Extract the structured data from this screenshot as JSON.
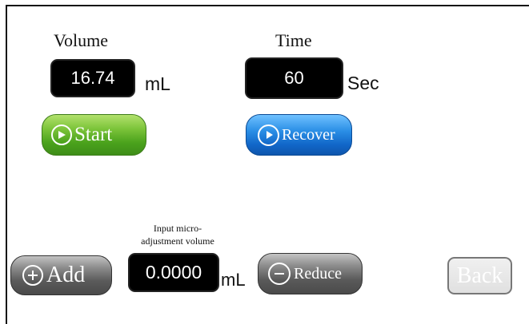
{
  "volume": {
    "label": "Volume",
    "value": "16.74",
    "unit": "mL"
  },
  "time": {
    "label": "Time",
    "value": "60",
    "unit": "Sec"
  },
  "buttons": {
    "start": "Start",
    "recover": "Recover",
    "add": "Add",
    "reduce": "Reduce",
    "back": "Back"
  },
  "micro_adjust": {
    "label_line1": "Input micro-",
    "label_line2": "adjustment volume",
    "value": "0.0000",
    "unit": "mL"
  },
  "colors": {
    "start_green": "#4aa21c",
    "recover_blue": "#1166c8",
    "gray_button": "#5a5a5a",
    "field_black": "#000000"
  },
  "icons": {
    "start": "play-circle-icon",
    "recover": "replay-circle-icon",
    "add": "plus-circle-icon",
    "reduce": "minus-circle-icon"
  }
}
